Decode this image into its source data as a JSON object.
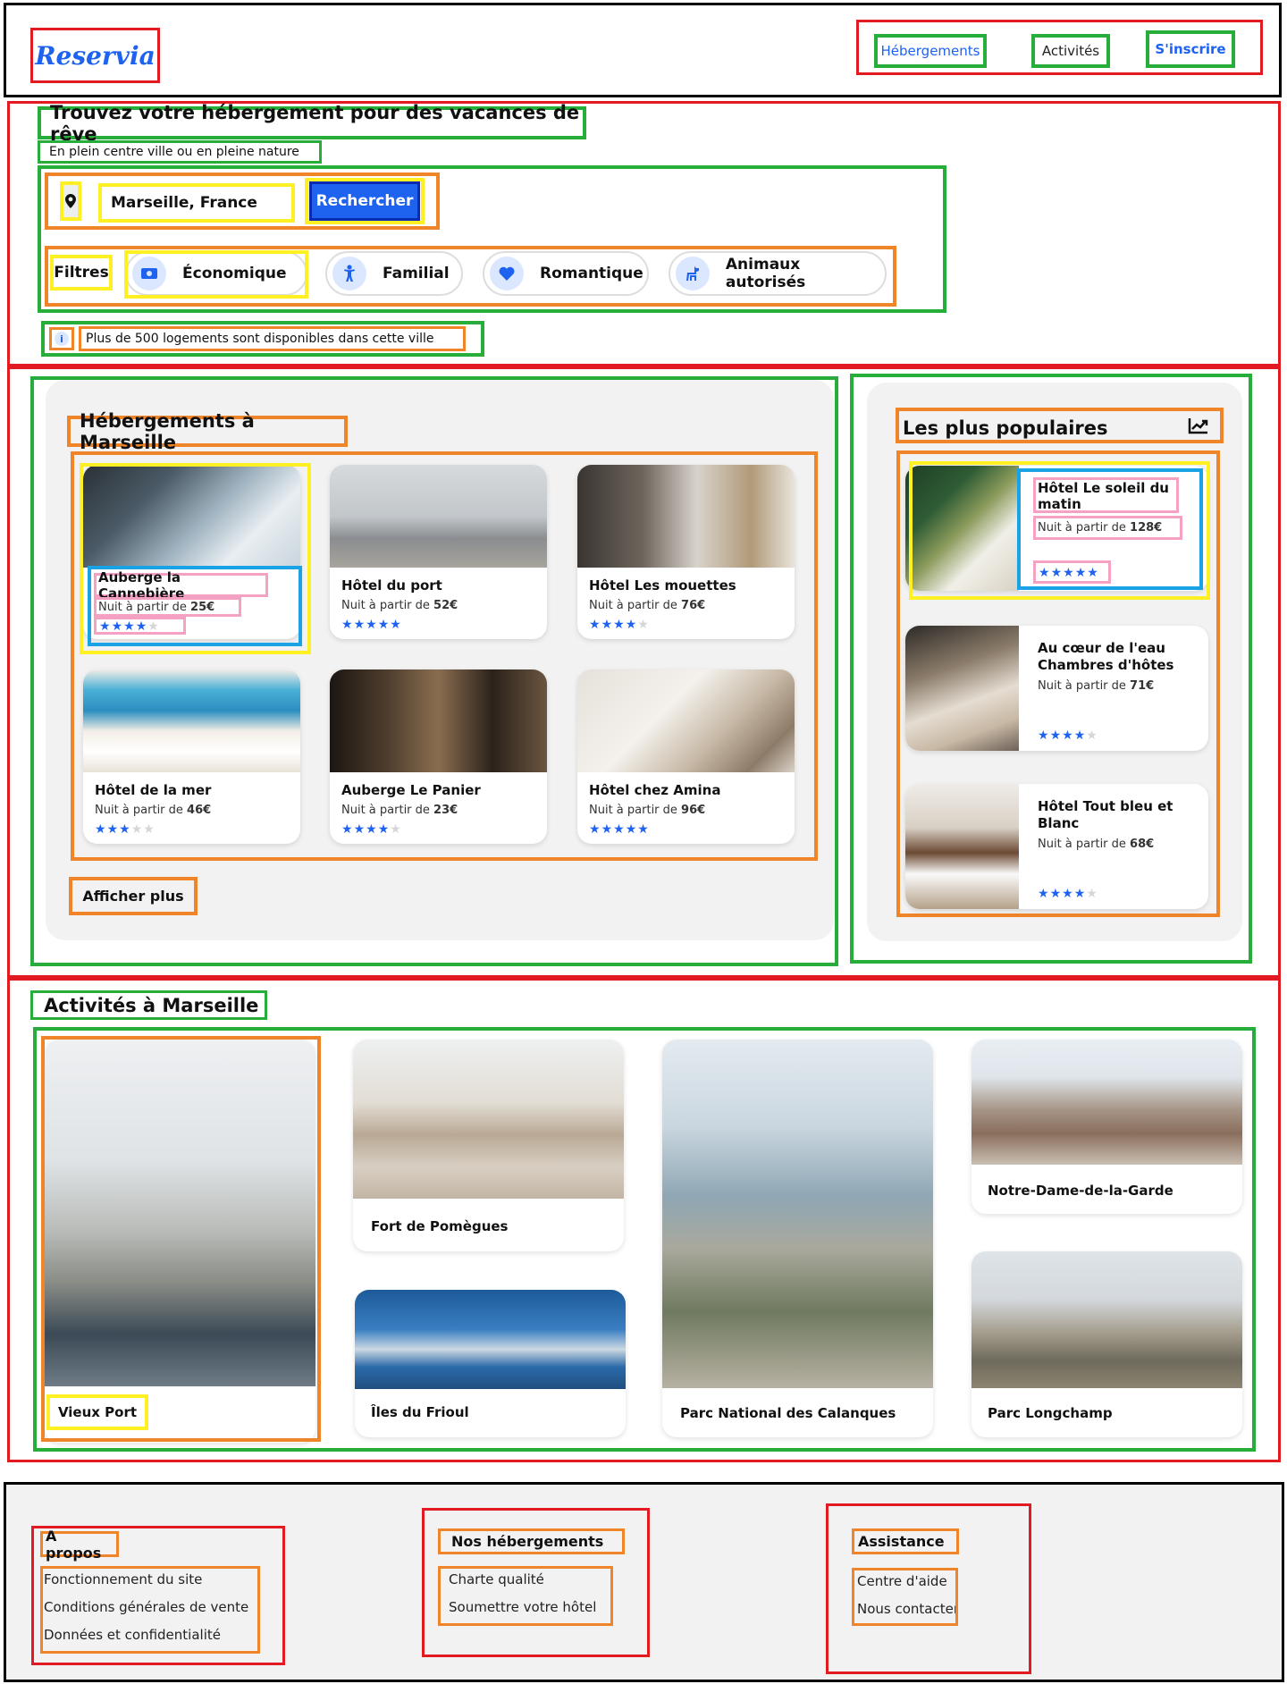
{
  "header": {
    "logo": "Reservia",
    "nav": {
      "hebergements": "Hébergements",
      "activites": "Activités",
      "inscrire": "S'inscrire"
    }
  },
  "hero": {
    "title": "Trouvez votre hébergement pour des vacances de rêve",
    "subtitle": "En plein centre ville ou en pleine nature",
    "search_value": "Marseille, France",
    "search_button": "Rechercher",
    "filters_label": "Filtres",
    "filters": [
      {
        "label": "Économique",
        "icon": "money-icon"
      },
      {
        "label": "Familial",
        "icon": "child-icon"
      },
      {
        "label": "Romantique",
        "icon": "heart-icon"
      },
      {
        "label": "Animaux autorisés",
        "icon": "dog-icon"
      }
    ],
    "info": "Plus de 500 logements sont disponibles dans cette ville"
  },
  "hotels": {
    "title": "Hébergements à Marseille",
    "price_prefix": "Nuit à partir de ",
    "items": [
      {
        "name": "Auberge la Cannebière",
        "price": "25€",
        "stars": 4
      },
      {
        "name": "Hôtel du port",
        "price": "52€",
        "stars": 5
      },
      {
        "name": "Hôtel Les mouettes",
        "price": "76€",
        "stars": 4
      },
      {
        "name": "Hôtel de la mer",
        "price": "46€",
        "stars": 3
      },
      {
        "name": "Auberge Le Panier",
        "price": "23€",
        "stars": 4
      },
      {
        "name": "Hôtel chez Amina",
        "price": "96€",
        "stars": 5
      }
    ],
    "more": "Afficher plus"
  },
  "popular": {
    "title": "Les plus populaires",
    "icon": "trend-chart-icon",
    "items": [
      {
        "name": "Hôtel Le soleil du matin",
        "price": "128€",
        "stars": 5
      },
      {
        "name": "Au cœur de l'eau Chambres d'hôtes",
        "price": "71€",
        "stars": 4
      },
      {
        "name": "Hôtel Tout bleu et Blanc",
        "price": "68€",
        "stars": 4
      }
    ]
  },
  "activities": {
    "title": "Activités à Marseille",
    "items": [
      "Vieux Port",
      "Fort de Pomègues",
      "Îles du Frioul",
      "Parc National des Calanques",
      "Notre-Dame-de-la-Garde",
      "Parc Longchamp"
    ]
  },
  "footer": {
    "about": {
      "title": "A propos",
      "links": [
        "Fonctionnement du site",
        "Conditions générales de vente",
        "Données et confidentialité"
      ]
    },
    "hebergements": {
      "title": "Nos hébergements",
      "links": [
        "Charte qualité",
        "Soumettre votre hôtel"
      ]
    },
    "assistance": {
      "title": "Assistance",
      "links": [
        "Centre d'aide",
        "Nous contacter"
      ]
    }
  },
  "colors": {
    "accent": "#1e62f0",
    "panel": "#f2f2f2"
  }
}
